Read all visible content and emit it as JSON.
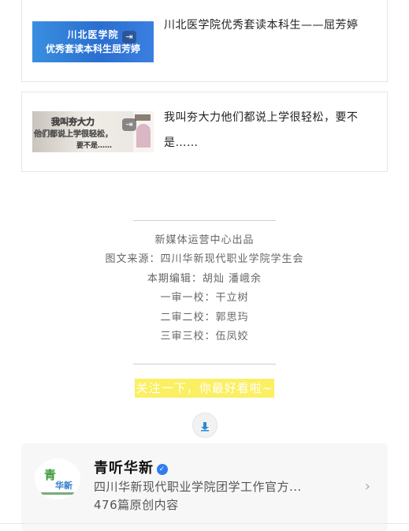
{
  "articles": [
    {
      "thumb_lines": [
        "川北医学院",
        "优秀套读本科生屈芳婷"
      ],
      "title": "川北医学院优秀套读本科生——屈芳婷",
      "share_icon": "share-icon"
    },
    {
      "thumb_lines": [
        "我叫夯大力",
        "他们都说上学很轻松，",
        "要不是……"
      ],
      "title": "我叫夯大力他们都说上学很轻松，要不是……",
      "share_icon": "share-icon"
    }
  ],
  "credits": {
    "producer": "新媒体运营中心出品",
    "source": "图文来源：四川华新现代职业学院学生会",
    "editor": "本期编辑：胡灿  潘峨余",
    "review1": "一审一校：干立树",
    "review2": "二审二校：郭思玙",
    "review3": "三审三校：伍凤姣"
  },
  "follow_text": "关注一下，你最好看啦~",
  "account": {
    "logo_text_1": "青",
    "logo_text_2": "华新",
    "name": "青听华新",
    "description": "四川华新现代职业学院团学工作官方...",
    "article_count": "476篇原创内容"
  },
  "colors": {
    "highlight": "#fbef62",
    "verify": "#2f7df0",
    "thumb_blue": "#2a6fd0"
  }
}
